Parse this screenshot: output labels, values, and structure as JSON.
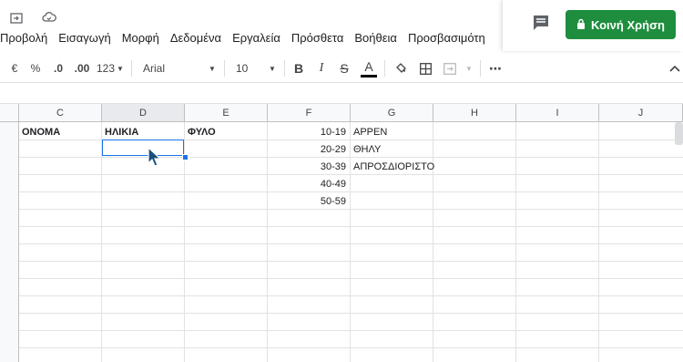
{
  "menu": [
    "Προβολή",
    "Εισαγωγή",
    "Μορφή",
    "Δεδομένα",
    "Εργαλεία",
    "Πρόσθετα",
    "Βοήθεια",
    "Προσβασιμότη"
  ],
  "share": {
    "label": "Κοινή Χρήση"
  },
  "toolbar": {
    "currency": "€",
    "percent": "%",
    "dec_decrease": ".0",
    "dec_increase": ".00",
    "format_more": "123",
    "font": "Arial",
    "font_size": "10",
    "bold": "B",
    "italic": "I",
    "strike": "S",
    "text_color": "A",
    "more": "⋯"
  },
  "colors": {
    "accent": "#1a73e8",
    "share_bg": "#1e8e3e"
  },
  "columns": [
    "C",
    "D",
    "E",
    "F",
    "G",
    "H",
    "I",
    "J"
  ],
  "selected_column": "D",
  "cells": {
    "headers": {
      "C": "ΟΝΟΜΑ",
      "D": "ΗΛΙΚΙΑ",
      "E": "ΦΥΛΟ"
    },
    "age_ranges": [
      "10-19",
      "20-29",
      "30-39",
      "40-49",
      "50-59"
    ],
    "genders": [
      "ΑΡΡΕΝ",
      "ΘΗΛΥ",
      "ΑΠΡΟΣΔΙΟΡΙΣΤΟ"
    ]
  }
}
